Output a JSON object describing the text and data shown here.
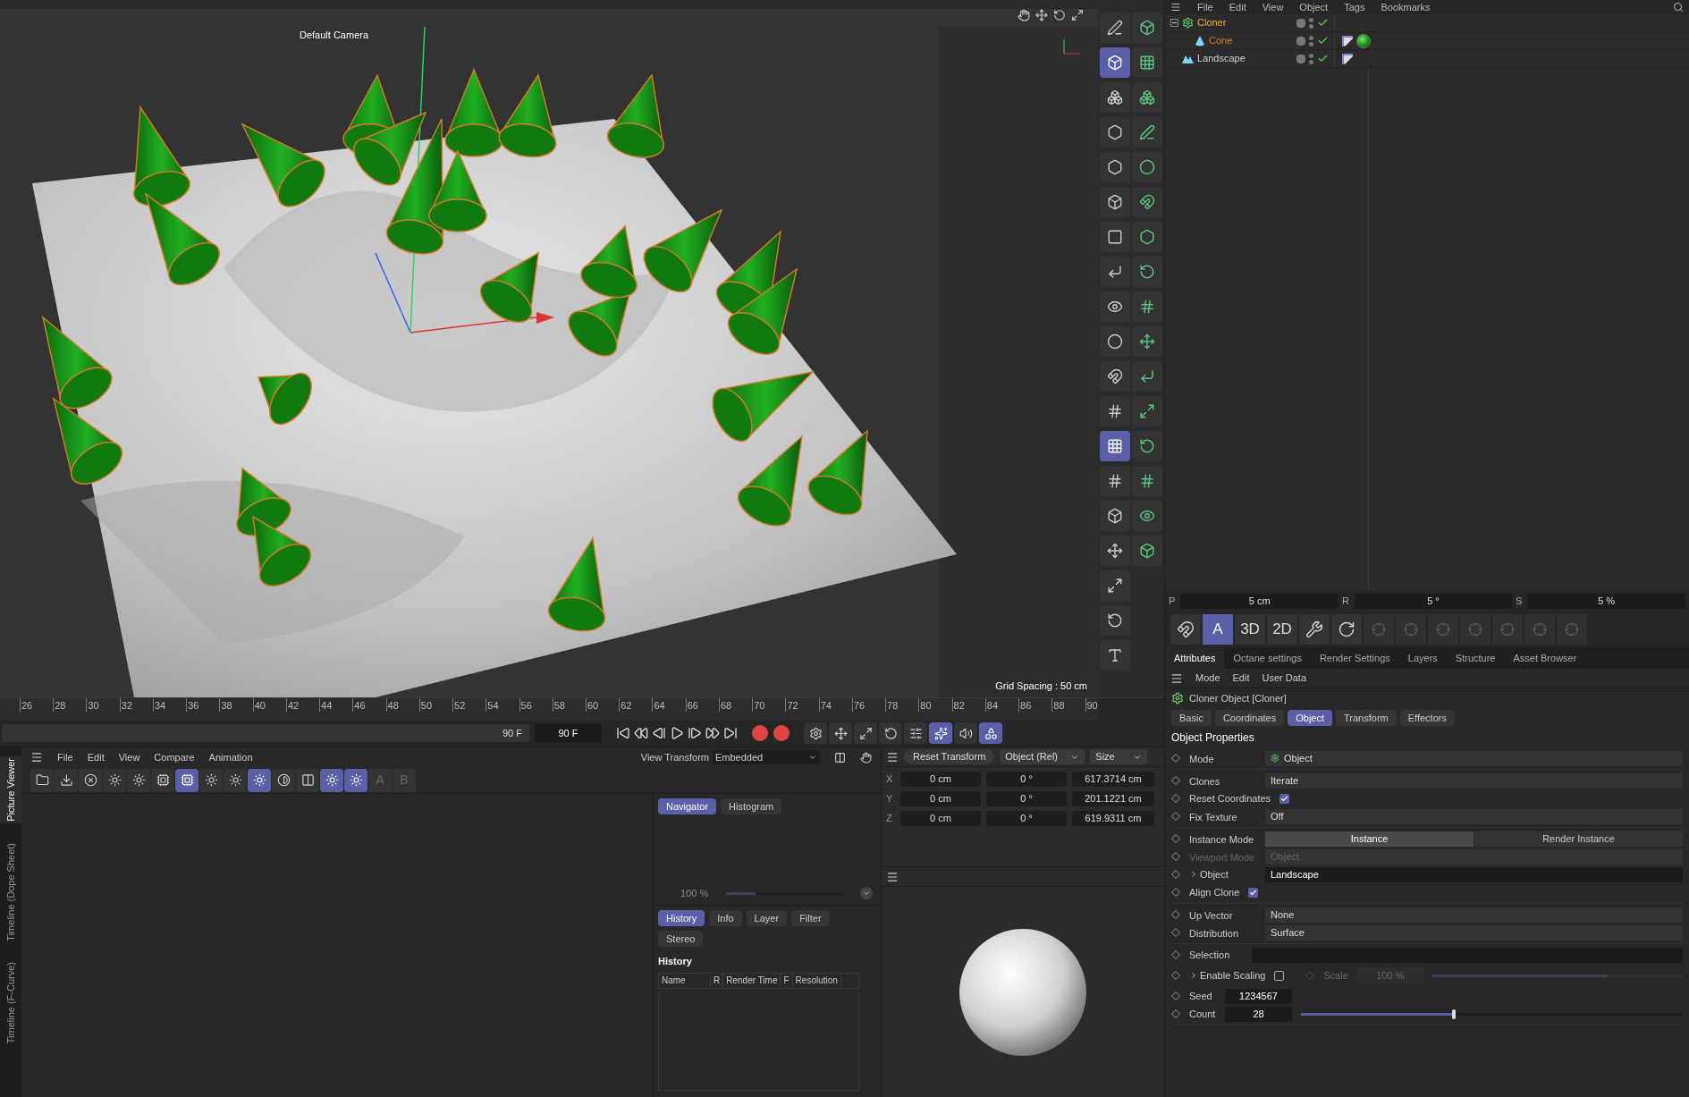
{
  "viewport": {
    "camera_label": "Default Camera",
    "grid_spacing": "Grid Spacing : 50 cm"
  },
  "mode_tools": [
    {
      "kind": "edit",
      "selected": false
    },
    {
      "kind": "model",
      "selected": true
    },
    {
      "kind": "object",
      "selected": false
    },
    {
      "kind": "points",
      "selected": false
    },
    {
      "kind": "edges",
      "selected": false
    },
    {
      "kind": "polygons",
      "selected": false
    },
    {
      "kind": "uv",
      "selected": false
    },
    {
      "kind": "axis",
      "selected": false
    },
    {
      "kind": "solo",
      "selected": false
    },
    {
      "kind": "texture",
      "selected": false
    },
    {
      "kind": "magnet",
      "selected": false
    },
    {
      "kind": "grid",
      "selected": false
    },
    {
      "kind": "workplane",
      "selected": true
    },
    {
      "kind": "grid",
      "selected": false
    },
    {
      "kind": "cube",
      "selected": false
    },
    {
      "kind": "move",
      "selected": false
    },
    {
      "kind": "scale",
      "selected": false
    },
    {
      "kind": "rotate",
      "selected": false
    },
    {
      "kind": "text",
      "selected": false
    }
  ],
  "object_manager": {
    "menu": [
      "File",
      "Edit",
      "View",
      "Object",
      "Tags",
      "Bookmarks"
    ],
    "objects": [
      {
        "name": "Cloner",
        "kind": "cloner",
        "color": "#f2b32b",
        "enabled": true,
        "expanded": true,
        "children": [
          {
            "name": "Cone",
            "kind": "cone",
            "color": "#d9822b",
            "enabled": true,
            "tags": [
              {
                "kind": "phong"
              },
              {
                "kind": "material"
              }
            ]
          }
        ]
      },
      {
        "name": "Landscape",
        "kind": "landscape",
        "color": "#d0d0d0",
        "enabled": true,
        "tags": [
          {
            "kind": "phong"
          }
        ]
      }
    ]
  },
  "snap_fields": [
    {
      "label": "P",
      "value": "5 cm"
    },
    {
      "label": "R",
      "value": "5 °"
    },
    {
      "label": "S",
      "value": "5 %"
    }
  ],
  "snap_tools": [
    {
      "kind": "magnet",
      "selected": false
    },
    {
      "kind": "text",
      "label": "A",
      "selected": true
    },
    {
      "kind": "text",
      "label": "3D",
      "selected": false
    },
    {
      "kind": "text",
      "label": "2D",
      "selected": false
    },
    {
      "kind": "wrench",
      "selected": false
    },
    {
      "kind": "quantize",
      "selected": false
    }
  ],
  "attributes": {
    "tabs": [
      {
        "label": "Attributes",
        "selected": true
      },
      {
        "label": "Octane settings",
        "selected": false
      },
      {
        "label": "Render Settings",
        "selected": false
      },
      {
        "label": "Layers",
        "selected": false
      },
      {
        "label": "Structure",
        "selected": false
      },
      {
        "label": "Asset Browser",
        "selected": false
      }
    ],
    "menu": [
      "Mode",
      "Edit",
      "User Data"
    ],
    "title": "Cloner Object [Cloner]",
    "subtabs": [
      {
        "label": "Basic",
        "selected": false
      },
      {
        "label": "Coordinates",
        "selected": false
      },
      {
        "label": "Object",
        "selected": true
      },
      {
        "label": "Transform",
        "selected": false
      },
      {
        "label": "Effectors",
        "selected": false
      }
    ],
    "section": "Object Properties",
    "groups": [
      [
        {
          "kind": "dropdown",
          "label": "Mode",
          "value": "Object",
          "icon": true,
          "disabled": false
        }
      ],
      [
        {
          "kind": "dropdown",
          "label": "Clones",
          "value": "Iterate",
          "disabled": false
        },
        {
          "kind": "checkbox",
          "label": "Reset Coordinates",
          "checked": true
        },
        {
          "kind": "dropdown",
          "label": "Fix Texture",
          "value": "Off",
          "disabled": false
        }
      ],
      [
        {
          "kind": "segmented",
          "label": "Instance Mode",
          "options": [
            {
              "label": "Instance",
              "selected": true
            },
            {
              "label": "Render Instance",
              "selected": false
            }
          ]
        },
        {
          "kind": "dropdown",
          "label": "Viewport Mode",
          "value": "Object",
          "disabled": true
        },
        {
          "kind": "link",
          "label": "Object",
          "value": "Landscape"
        },
        {
          "kind": "checkbox",
          "label": "Align Clone",
          "checked": true
        }
      ],
      [
        {
          "kind": "dropdown",
          "label": "Up Vector",
          "value": "None",
          "disabled": false
        },
        {
          "kind": "dropdown",
          "label": "Distribution",
          "value": "Surface",
          "disabled": false
        }
      ],
      [
        {
          "kind": "selection",
          "label": "Selection"
        },
        {
          "kind": "scaling",
          "label": "Enable Scaling",
          "checked": false,
          "sub_label": "Scale",
          "sub_value": "100 %",
          "level": 0.7
        },
        {
          "kind": "number",
          "label": "Seed",
          "value": "1234567"
        },
        {
          "kind": "slider",
          "label": "Count",
          "value": "28",
          "level": 0.4
        }
      ]
    ]
  },
  "timeline": {
    "ticks": [
      "26",
      "28",
      "30",
      "32",
      "34",
      "36",
      "38",
      "40",
      "42",
      "44",
      "46",
      "48",
      "50",
      "52",
      "54",
      "56",
      "58",
      "60",
      "62",
      "64",
      "66",
      "68",
      "70",
      "72",
      "74",
      "76",
      "78",
      "80",
      "82",
      "84",
      "86",
      "88",
      "90"
    ],
    "end_frame": "90 F",
    "current_frame": "90 F"
  },
  "playback_tools": [
    {
      "kind": "settings",
      "selected": false
    },
    {
      "kind": "move",
      "selected": false
    },
    {
      "kind": "scale",
      "selected": false
    },
    {
      "kind": "rotate",
      "selected": false
    },
    {
      "kind": "param",
      "selected": false
    },
    {
      "kind": "pla",
      "selected": true
    },
    {
      "kind": "sound",
      "selected": false
    },
    {
      "kind": "track",
      "selected": true
    }
  ],
  "picture_viewer": {
    "side_tabs": [
      {
        "label": "Picture Viewer",
        "selected": true
      },
      {
        "label": "Timeline (Dope Sheet)",
        "selected": false
      },
      {
        "label": "Timeline (F-Curve)",
        "selected": false
      }
    ],
    "menu": [
      "File",
      "Edit",
      "View",
      "Compare",
      "Animation"
    ],
    "view_transform_label": "View Transform",
    "view_transform": "Embedded",
    "toolbar": [
      {
        "kind": "folder",
        "selected": false
      },
      {
        "kind": "save",
        "selected": false
      },
      {
        "kind": "stop",
        "selected": false
      },
      {
        "kind": "burst",
        "selected": false
      },
      {
        "kind": "burst",
        "selected": false
      },
      {
        "kind": "chip",
        "selected": false
      },
      {
        "kind": "chip",
        "selected": true
      },
      {
        "kind": "burst",
        "selected": false
      },
      {
        "kind": "burst",
        "selected": false
      },
      {
        "kind": "burst",
        "selected": true
      },
      {
        "kind": "contrast",
        "selected": false
      },
      {
        "kind": "compare",
        "selected": false
      },
      {
        "kind": "burst",
        "selected": true
      },
      {
        "kind": "burst",
        "selected": true
      }
    ],
    "toolbar_letters": [
      "A",
      "B"
    ],
    "nav_tabs": [
      {
        "label": "Navigator",
        "selected": true
      },
      {
        "label": "Histogram",
        "selected": false
      }
    ],
    "zoom": {
      "value": "100 %",
      "level": 0.25
    },
    "info_tabs": [
      {
        "label": "History",
        "selected": true
      },
      {
        "label": "Info",
        "selected": false
      },
      {
        "label": "Layer",
        "selected": false
      },
      {
        "label": "Filter",
        "selected": false
      },
      {
        "label": "Stereo",
        "selected": false
      }
    ],
    "history_title": "History",
    "history_columns": [
      "Name",
      "R",
      "Render Time",
      "F",
      "Resolution"
    ]
  },
  "coordinates": {
    "reset": "Reset Transform",
    "mode": "Object (Rel)",
    "size_mode": "Size",
    "rows": [
      {
        "axis": "X",
        "position": "0 cm",
        "rotation": "0 °",
        "size": "617.3714 cm"
      },
      {
        "axis": "Y",
        "position": "0 cm",
        "rotation": "0 °",
        "size": "201.1221 cm"
      },
      {
        "axis": "Z",
        "position": "0 cm",
        "rotation": "0 °",
        "size": "619.9311 cm"
      }
    ]
  }
}
